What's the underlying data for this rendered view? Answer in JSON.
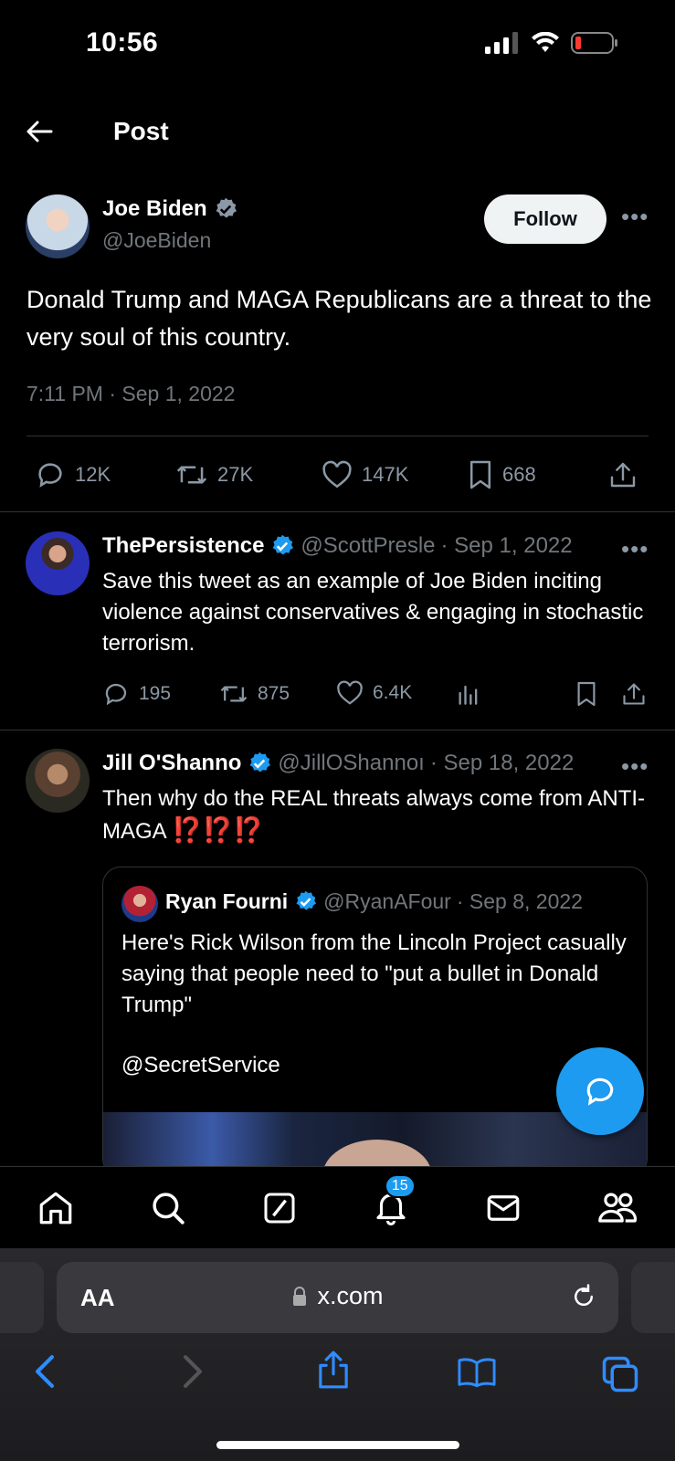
{
  "status": {
    "time": "10:56"
  },
  "header": {
    "title": "Post"
  },
  "tweet": {
    "name": "Joe Biden",
    "handle": "@JoeBiden",
    "follow_label": "Follow",
    "text": "Donald Trump and MAGA Republicans are a threat to the very soul of this country.",
    "timestamp": "7:11 PM · Sep 1, 2022",
    "stats": {
      "replies": "12K",
      "reposts": "27K",
      "likes": "147K",
      "bookmarks": "668"
    }
  },
  "replies": [
    {
      "name": "ThePersistence",
      "handle": "@ScottPresle",
      "date": "· Sep 1, 2022",
      "text": "Save this tweet as an example of Joe Biden inciting violence against conservatives & engaging in stochastic terrorism.",
      "stats": {
        "replies": "195",
        "reposts": "875",
        "likes": "6.4K"
      }
    },
    {
      "name": "Jill O'Shanno",
      "handle": "@JillOShannoı",
      "date": "· Sep 18, 2022",
      "text": "Then why do the REAL threats always come from ANTI-MAGA",
      "emoji": "⁉️⁉️⁉️",
      "quote": {
        "name": "Ryan Fourni",
        "handle": "@RyanAFour",
        "date": "· Sep 8, 2022",
        "text": "Here's Rick Wilson from the Lincoln Project casually saying that people need to \"put a bullet in Donald Trump\"",
        "mention": "@SecretService"
      }
    }
  ],
  "tabbar": {
    "notification_count": "15"
  },
  "safari": {
    "aa_label": "AA",
    "url": "x.com"
  },
  "icons": [
    "back-arrow-icon",
    "verified-icon",
    "reply-icon",
    "repost-icon",
    "like-icon",
    "bookmark-icon",
    "share-icon",
    "views-icon",
    "home-icon",
    "search-icon",
    "grok-icon",
    "bell-icon",
    "mail-icon",
    "communities-icon",
    "lock-icon",
    "reload-icon",
    "compose-reply-icon"
  ],
  "colors": {
    "accent": "#1d9bf0",
    "background": "#000000",
    "text": "#e7e9ea",
    "muted": "#71767b"
  }
}
